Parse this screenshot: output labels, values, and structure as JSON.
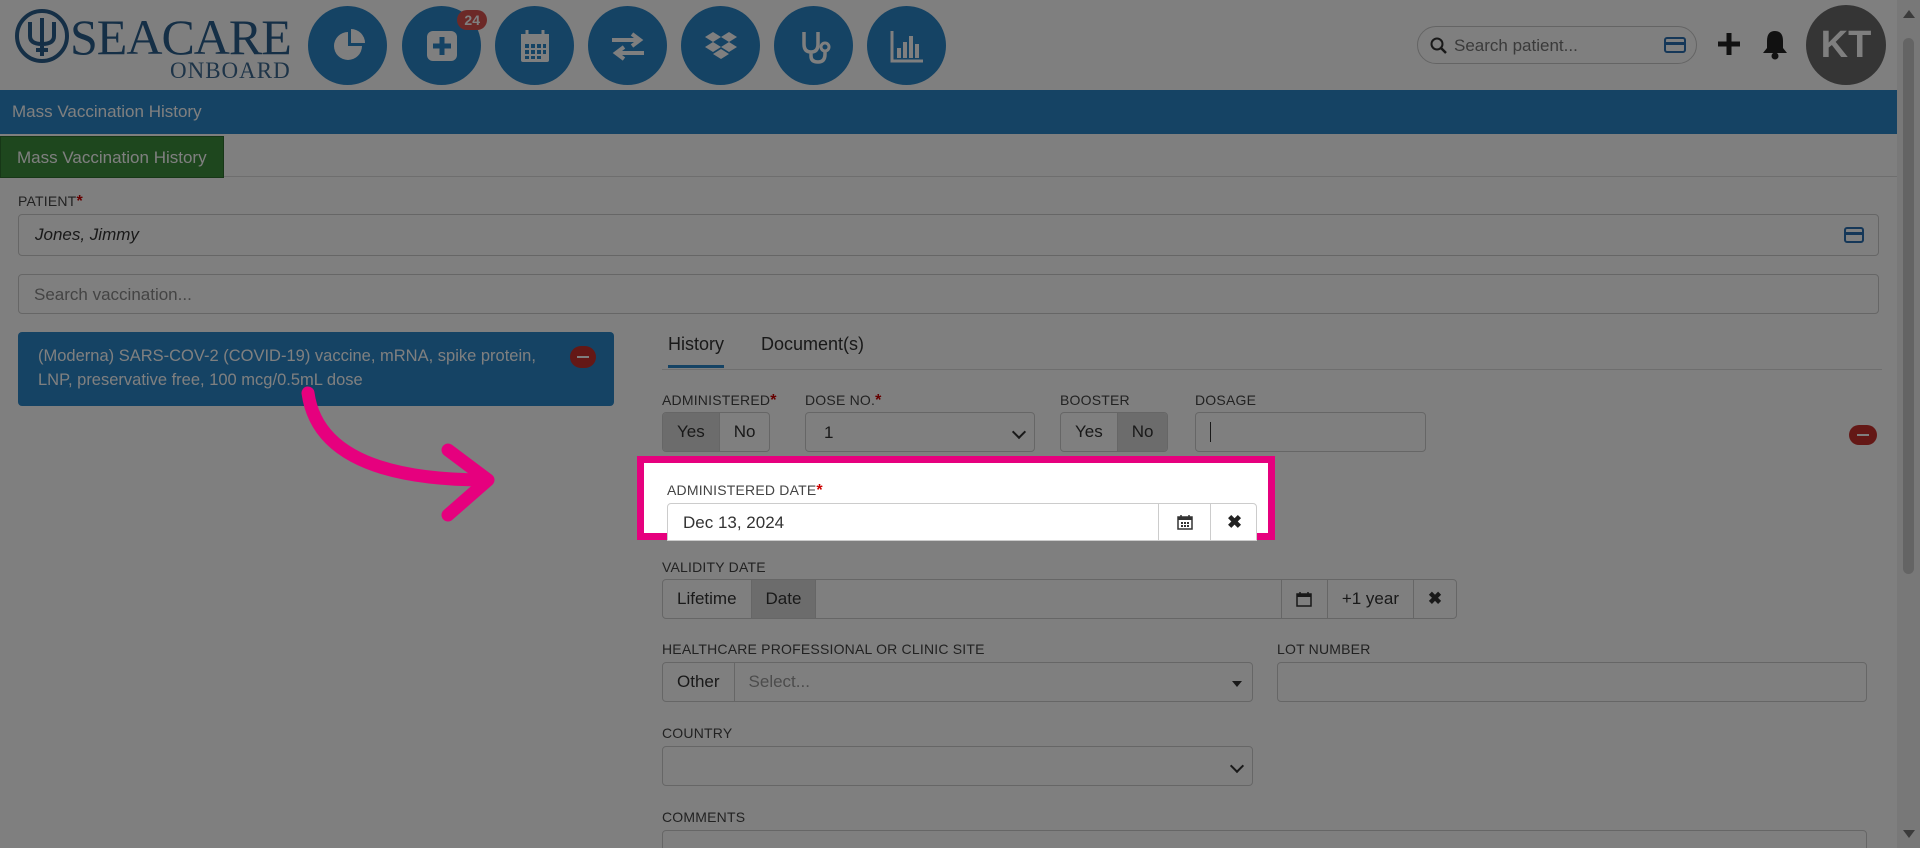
{
  "brand": {
    "wordmark": "SEACARE",
    "sub": "ONBOARD"
  },
  "nav": {
    "badge_count": "24",
    "icons": [
      "dashboard-icon",
      "add-icon",
      "calendar-icon",
      "transfer-icon",
      "dropbox-icon",
      "stethoscope-icon",
      "chart-icon"
    ]
  },
  "search": {
    "placeholder": "Search patient..."
  },
  "user": {
    "initials": "KT"
  },
  "page": {
    "title": "Mass Vaccination History",
    "tab": "Mass Vaccination History"
  },
  "patient": {
    "label": "PATIENT",
    "value": "Jones, Jimmy"
  },
  "vaccination_search": {
    "placeholder": "Search vaccination..."
  },
  "selected_vaccine": "(Moderna) SARS-COV-2 (COVID-19) vaccine, mRNA, spike protein, LNP, preservative free, 100 mcg/0.5mL dose",
  "tabs": [
    "History",
    "Document(s)"
  ],
  "form": {
    "administered": {
      "label": "ADMINISTERED",
      "yes": "Yes",
      "no": "No",
      "selected": "Yes"
    },
    "dose_no": {
      "label": "DOSE NO.",
      "value": "1"
    },
    "booster": {
      "label": "BOOSTER",
      "yes": "Yes",
      "no": "No",
      "selected": "No"
    },
    "dosage": {
      "label": "DOSAGE",
      "value": ""
    },
    "administered_date": {
      "label": "ADMINISTERED DATE",
      "value": "Dec 13, 2024"
    },
    "validity_date": {
      "label": "VALIDITY DATE",
      "lifetime": "Lifetime",
      "date": "Date",
      "selected": "Date",
      "plus_year": "+1 year"
    },
    "healthcare": {
      "label": "HEALTHCARE PROFESSIONAL OR CLINIC SITE",
      "other": "Other",
      "placeholder": "Select..."
    },
    "lot_number": {
      "label": "LOT NUMBER",
      "value": ""
    },
    "country": {
      "label": "COUNTRY",
      "value": ""
    },
    "comments": {
      "label": "COMMENTS"
    }
  },
  "colors": {
    "primary": "#2a87c8",
    "green_tab": "#3c8e3c",
    "highlight": "#e6007e",
    "danger": "#c9302c"
  }
}
